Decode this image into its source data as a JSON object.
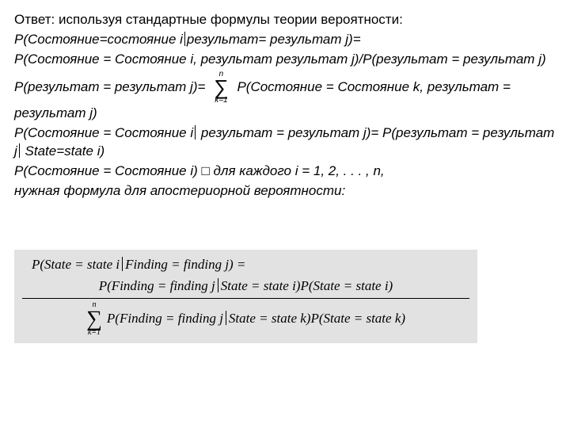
{
  "text": {
    "line1": "Ответ: используя стандартные формулы теории вероятности:",
    "line2_a": "P(Состояние=состояние i",
    "line2_b": "результат= результат j)=",
    "line3": "P(Состояние = Состояние i, результат результат j)/P(результат = результат j)",
    "line4_a": "P(результат = результат j)= ",
    "line4_b": " P(Состояние = Состояние k, результат = результат j)",
    "line5_a": "P(Состояние = Состояние i",
    "line5_b": "  результат = результат j)= P(результат = результат j",
    "line5_c": " State=state i)",
    "line6": "P(Состояние = Состояние i) ",
    "line6b": " для каждого i = 1, 2, . . . , n,",
    "line7": "нужная формула для апостериорной вероятности:",
    "sq": "□"
  },
  "sum": {
    "top": "n",
    "mid": "∑",
    "bot": "k=1"
  },
  "formula": {
    "row1_a": "P(State = state i",
    "row1_b": "Finding = finding j) =",
    "num_a": "P(Finding = finding j",
    "num_b": "State = state i)P(State = state i)",
    "den_a": " P(Finding = finding j",
    "den_b": "State = state k)P(State = state k)"
  }
}
